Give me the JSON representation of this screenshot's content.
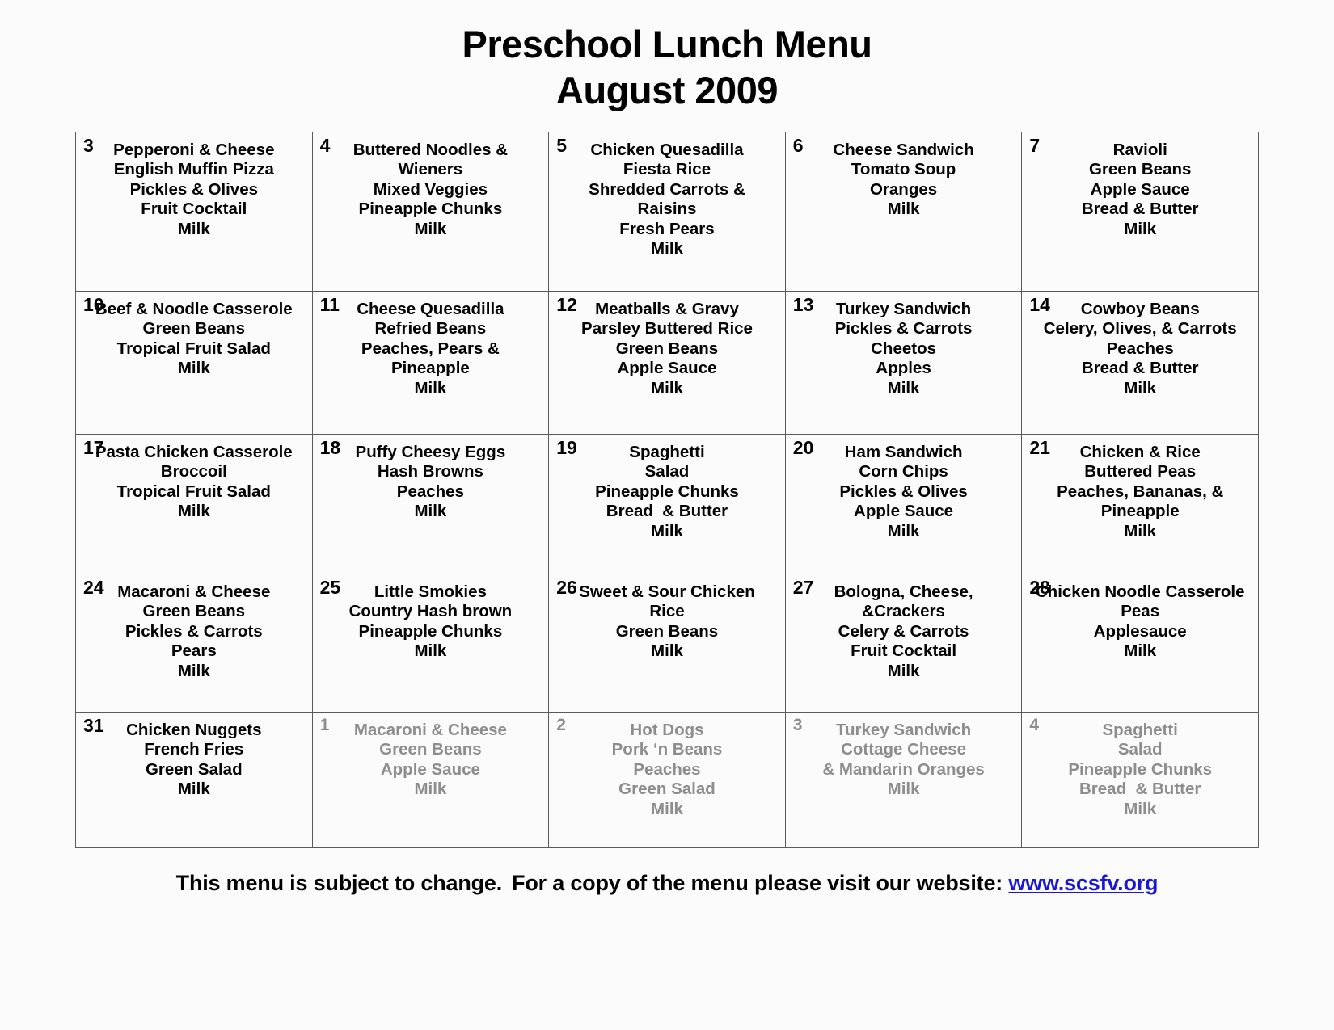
{
  "title": {
    "line1": "Preschool Lunch Menu",
    "line2": "August 2009"
  },
  "colors": {
    "text": "#000000",
    "muted_text": "#8d8d8d",
    "link": "#1a17d4",
    "grid_border": "#5a5a5a",
    "background": "#fbfbfb"
  },
  "calendar": {
    "weeks": [
      {
        "days": [
          {
            "number": "3",
            "other_month": false,
            "items": [
              "Pepperoni & Cheese",
              "English Muffin Pizza",
              "Pickles & Olives",
              "Fruit Cocktail",
              "Milk"
            ]
          },
          {
            "number": "4",
            "other_month": false,
            "items": [
              "Buttered Noodles &",
              "Wieners",
              "Mixed Veggies",
              "Pineapple Chunks",
              "Milk"
            ]
          },
          {
            "number": "5",
            "other_month": false,
            "items": [
              "Chicken Quesadilla",
              "Fiesta Rice",
              "Shredded Carrots &",
              "Raisins",
              "Fresh Pears",
              "Milk"
            ]
          },
          {
            "number": "6",
            "other_month": false,
            "items": [
              "Cheese Sandwich",
              "Tomato Soup",
              "Oranges",
              "Milk"
            ]
          },
          {
            "number": "7",
            "other_month": false,
            "items": [
              "Ravioli",
              "Green Beans",
              "Apple Sauce",
              "Bread & Butter",
              "Milk"
            ]
          }
        ]
      },
      {
        "days": [
          {
            "number": "10",
            "other_month": false,
            "items": [
              "Beef & Noodle Casserole",
              "Green Beans",
              "Tropical Fruit Salad",
              "Milk"
            ]
          },
          {
            "number": "11",
            "other_month": false,
            "items": [
              "Cheese Quesadilla",
              "Refried Beans",
              "Peaches, Pears &",
              "Pineapple",
              "Milk"
            ]
          },
          {
            "number": "12",
            "other_month": false,
            "items": [
              "Meatballs & Gravy",
              "Parsley Buttered Rice",
              "Green Beans",
              "Apple Sauce",
              "Milk"
            ]
          },
          {
            "number": "13",
            "other_month": false,
            "items": [
              "Turkey Sandwich",
              "Pickles & Carrots",
              "Cheetos",
              "Apples",
              "Milk"
            ]
          },
          {
            "number": "14",
            "other_month": false,
            "items": [
              "Cowboy Beans",
              "Celery, Olives, & Carrots",
              "Peaches",
              "Bread & Butter",
              "Milk"
            ]
          }
        ]
      },
      {
        "days": [
          {
            "number": "17",
            "other_month": false,
            "items": [
              "Pasta Chicken Casserole",
              "Broccoil",
              "Tropical Fruit Salad",
              "Milk"
            ]
          },
          {
            "number": "18",
            "other_month": false,
            "items": [
              "Puffy Cheesy Eggs",
              "Hash Browns",
              "Peaches",
              "Milk"
            ]
          },
          {
            "number": "19",
            "other_month": false,
            "items": [
              "Spaghetti",
              "Salad",
              "Pineapple Chunks",
              "Bread  & Butter",
              "Milk"
            ]
          },
          {
            "number": "20",
            "other_month": false,
            "items": [
              "Ham Sandwich",
              "Corn Chips",
              "Pickles & Olives",
              "Apple Sauce",
              "Milk"
            ]
          },
          {
            "number": "21",
            "other_month": false,
            "items": [
              "Chicken & Rice",
              "Buttered Peas",
              "Peaches, Bananas, &",
              "Pineapple",
              "Milk"
            ]
          }
        ]
      },
      {
        "days": [
          {
            "number": "24",
            "other_month": false,
            "items": [
              "Macaroni & Cheese",
              "Green Beans",
              "Pickles & Carrots",
              "Pears",
              "Milk"
            ]
          },
          {
            "number": "25",
            "other_month": false,
            "items": [
              "Little Smokies",
              "Country Hash brown",
              "Pineapple Chunks",
              "Milk"
            ]
          },
          {
            "number": "26",
            "other_month": false,
            "items": [
              "Sweet & Sour Chicken",
              "Rice",
              "Green Beans",
              "Milk"
            ]
          },
          {
            "number": "27",
            "other_month": false,
            "items": [
              "Bologna, Cheese,",
              "&Crackers",
              "Celery & Carrots",
              "Fruit Cocktail",
              "Milk"
            ]
          },
          {
            "number": "28",
            "other_month": false,
            "items": [
              "Chicken Noodle Casserole",
              "Peas",
              "Applesauce",
              "Milk"
            ]
          }
        ]
      },
      {
        "days": [
          {
            "number": "31",
            "other_month": false,
            "items": [
              "Chicken Nuggets",
              "French Fries",
              "Green Salad",
              "Milk"
            ]
          },
          {
            "number": "1",
            "other_month": true,
            "items": [
              "Macaroni & Cheese",
              "Green Beans",
              "Apple Sauce",
              "Milk"
            ]
          },
          {
            "number": "2",
            "other_month": true,
            "items": [
              "Hot Dogs",
              "Pork ‘n Beans",
              "Peaches",
              "Green Salad",
              "Milk"
            ]
          },
          {
            "number": "3",
            "other_month": true,
            "items": [
              "Turkey Sandwich",
              "Cottage Cheese",
              "& Mandarin Oranges",
              "Milk"
            ]
          },
          {
            "number": "4",
            "other_month": true,
            "items": [
              "Spaghetti",
              "Salad",
              "Pineapple Chunks",
              "Bread  & Butter",
              "Milk"
            ]
          }
        ]
      }
    ]
  },
  "footer": {
    "notice": "This menu is subject to change.",
    "instruction": "For a copy of the menu please visit our website:",
    "link_text": "www.scsfv.org"
  }
}
